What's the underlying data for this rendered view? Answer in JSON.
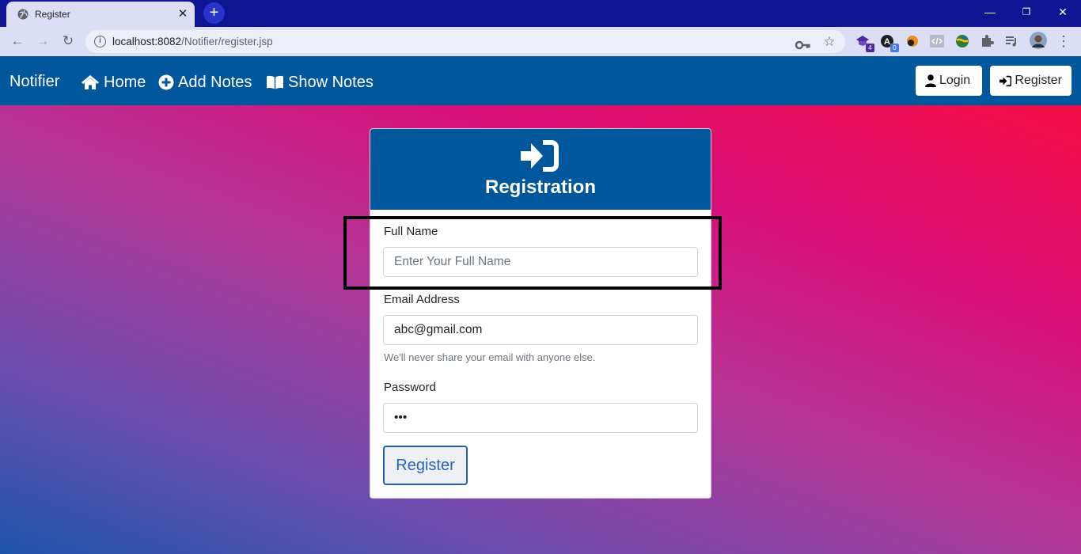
{
  "browser": {
    "tab_title": "Register",
    "tab_close": "✕",
    "new_tab": "+",
    "url_host": "localhost:8082",
    "url_path": "/Notifier/register.jsp",
    "window_controls": [
      "—",
      "❐",
      "✕"
    ],
    "extension_badges": {
      "ext1": "4",
      "ext2": "0"
    }
  },
  "navbar": {
    "brand": "Notifier",
    "links": [
      {
        "label": "Home",
        "icon": "home-icon"
      },
      {
        "label": "Add Notes",
        "icon": "plus-circle-icon"
      },
      {
        "label": "Show Notes",
        "icon": "book-icon"
      }
    ],
    "login_label": "Login",
    "register_label": "Register"
  },
  "form": {
    "title": "Registration",
    "full_name": {
      "label": "Full Name",
      "placeholder": "Enter Your Full Name",
      "value": ""
    },
    "email": {
      "label": "Email Address",
      "value": "abc@gmail.com",
      "help": "We'll never share your email with anyone else."
    },
    "password": {
      "label": "Password",
      "value": "abc"
    },
    "submit_label": "Register"
  },
  "colors": {
    "navbar": "#01579b",
    "tabstrip": "#0f1492",
    "toolbar": "#dcdef5",
    "accent_button": "#2161b0"
  }
}
